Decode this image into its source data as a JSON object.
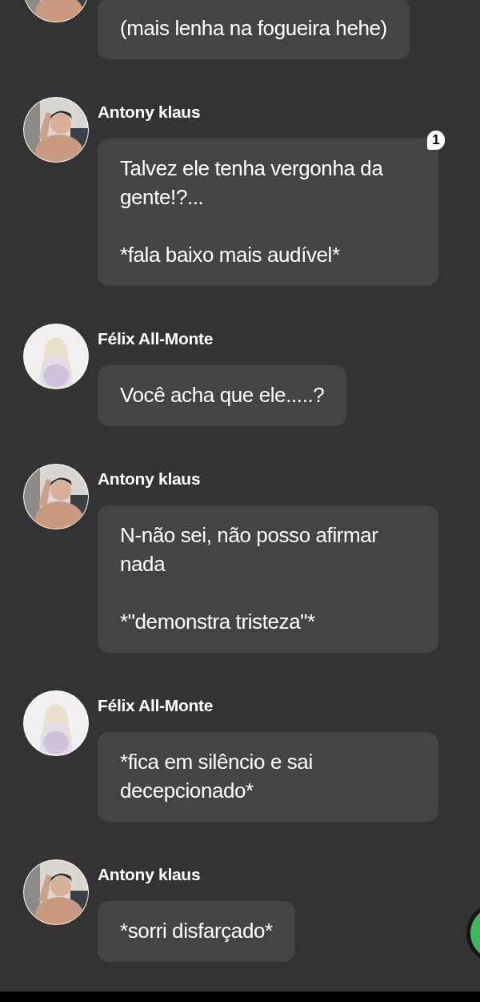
{
  "messages": [
    {
      "text": "(mais lenha na fogueira hehe)"
    },
    {
      "sender": "Antony klaus",
      "text": "Talvez ele tenha vergonha da gente!?...\n\n*fala baixo mais audível*",
      "badge": "1"
    },
    {
      "sender": "Félix All-Monte",
      "text": "Você acha que ele.....?"
    },
    {
      "sender": "Antony klaus",
      "text": "N-não sei, não posso afirmar nada\n\n*\"demonstra tristeza\"*"
    },
    {
      "sender": "Félix All-Monte",
      "text": "*fica em silêncio e sai decepcionado*"
    },
    {
      "sender": "Antony klaus",
      "text": "*sorri disfarçado*"
    }
  ]
}
